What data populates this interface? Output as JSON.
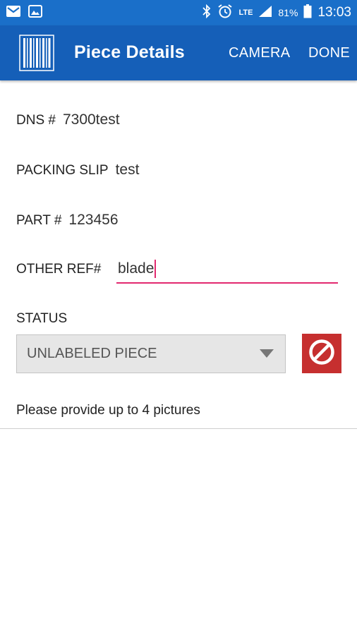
{
  "status_bar": {
    "battery": "81%",
    "time": "13:03",
    "network": "LTE",
    "icons": [
      "gmail-icon",
      "gallery-icon",
      "bluetooth-icon",
      "alarm-icon",
      "signal-icon",
      "battery-icon"
    ]
  },
  "app_bar": {
    "title": "Piece Details",
    "camera_label": "CAMERA",
    "done_label": "DONE",
    "logo_icon": "barcode-icon"
  },
  "fields": {
    "dns_label": "DNS #",
    "dns_value": "7300test",
    "packing_slip_label": "PACKING SLIP",
    "packing_slip_value": "test",
    "part_label": "PART #",
    "part_value": "123456",
    "other_ref_label": "OTHER REF#",
    "other_ref_value": "blade"
  },
  "status": {
    "label": "STATUS",
    "selected": "UNLABELED PIECE",
    "clear_icon": "prohibit-icon"
  },
  "hint": "Please provide up to 4 pictures",
  "colors": {
    "status_bar": "#1a6fc9",
    "app_bar": "#155fb8",
    "input_underline": "#e2296f",
    "clear_button": "#c62f2f"
  }
}
